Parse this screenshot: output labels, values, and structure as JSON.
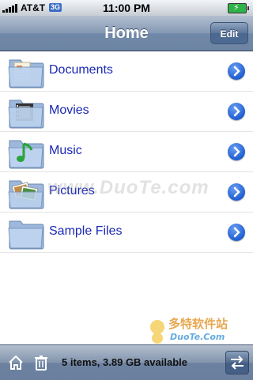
{
  "status_bar": {
    "carrier": "AT&T",
    "network": "3G",
    "time": "11:00 PM",
    "battery_state": "charging"
  },
  "nav": {
    "title": "Home",
    "edit_label": "Edit"
  },
  "items": [
    {
      "label": "Documents",
      "icon": "documents-folder-icon"
    },
    {
      "label": "Movies",
      "icon": "movies-folder-icon"
    },
    {
      "label": "Music",
      "icon": "music-folder-icon"
    },
    {
      "label": "Pictures",
      "icon": "pictures-folder-icon"
    },
    {
      "label": "Sample Files",
      "icon": "folder-icon"
    }
  ],
  "toolbar": {
    "status": "5 items, 3.89 GB available"
  },
  "watermarks": {
    "center": "www.DuoTe.com",
    "corner_brand": "多特软件站",
    "corner_url": "DuoTe.Com"
  },
  "colors": {
    "link_text": "#1a27b4",
    "accent": "#1f5fd2",
    "navbar": "#6d84a3"
  }
}
